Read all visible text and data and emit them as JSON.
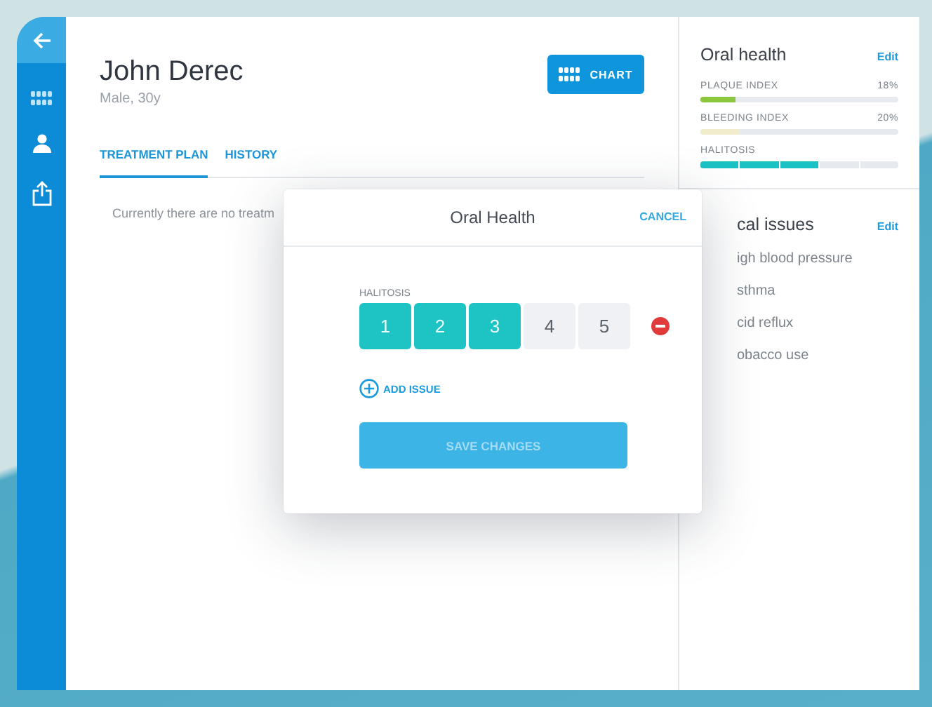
{
  "patient": {
    "name": "John Derec",
    "details": "Male, 30y"
  },
  "chart_button": "CHART",
  "tabs": [
    {
      "label": "TREATMENT PLAN",
      "selected": true
    },
    {
      "label": "HISTORY",
      "selected": false
    }
  ],
  "empty_message": "Currently there are no treatm",
  "oral_health": {
    "title": "Oral health",
    "edit": "Edit",
    "indices": [
      {
        "kind": "bar",
        "label": "PLAQUE INDEX",
        "reading": "18%",
        "level": 0.18,
        "color": "#8cc63f"
      },
      {
        "kind": "bar",
        "label": "BLEEDING INDEX",
        "reading": "20%",
        "level": 0.2,
        "color": "#f1eccb"
      },
      {
        "kind": "segmented",
        "label": "HALITOSIS",
        "level": 0.6,
        "color": "#1bc2c4"
      }
    ]
  },
  "medical_issues": {
    "title": "cal issues",
    "edit": "Edit",
    "items": [
      "igh blood pressure",
      "sthma",
      "cid reflux",
      "obacco use"
    ]
  },
  "modal": {
    "title": "Oral Health",
    "cancel": "CANCEL",
    "issue": {
      "label": "HALITOSIS",
      "scores": [
        {
          "label": "1",
          "on": true
        },
        {
          "label": "2",
          "on": true
        },
        {
          "label": "3",
          "on": true
        },
        {
          "label": "4",
          "on": false
        },
        {
          "label": "5",
          "on": false
        }
      ]
    },
    "add_issue": "ADD ISSUE",
    "save": "SAVE CHANGES"
  }
}
